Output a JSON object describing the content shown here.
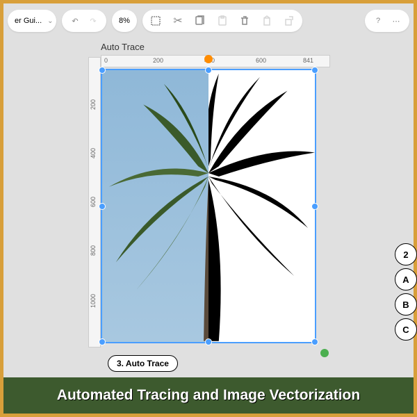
{
  "toolbar": {
    "doc_title": "er Gui...",
    "zoom_pct": "8%"
  },
  "canvas": {
    "title": "Auto Trace",
    "ruler_x": [
      "0",
      "200",
      "400",
      "600",
      "841"
    ],
    "ruler_y": [
      "200",
      "400",
      "600",
      "800",
      "1000"
    ]
  },
  "step_label": "3. Auto Trace",
  "side_markers": [
    "2",
    "A",
    "B",
    "C"
  ],
  "banner": "Automated Tracing and Image Vectorization"
}
